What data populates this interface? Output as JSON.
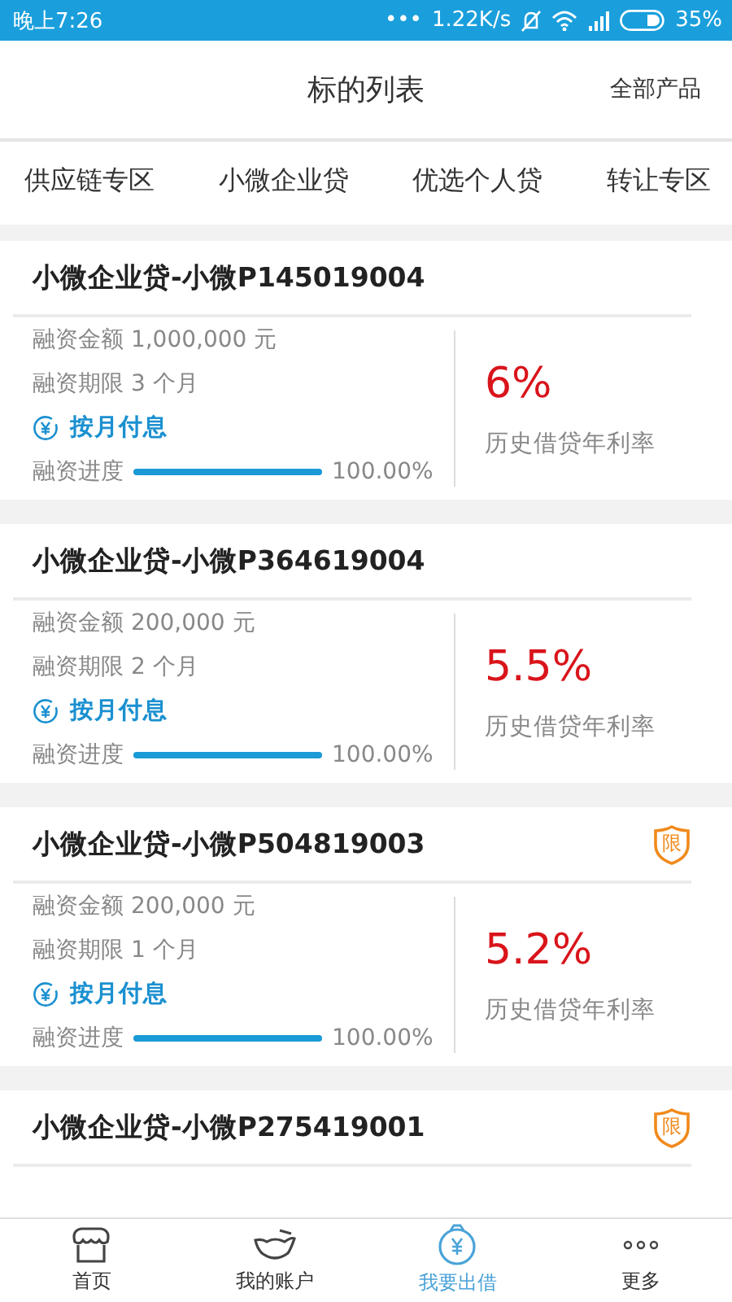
{
  "status_bar": {
    "time": "晚上7:26",
    "dots": "•••",
    "speed": "1.22K/s",
    "battery": "35%"
  },
  "header": {
    "title": "标的列表",
    "action": "全部产品"
  },
  "tabs": [
    {
      "label": "供应链专区",
      "selected": false
    },
    {
      "label": "小微企业贷",
      "selected": false
    },
    {
      "label": "优选个人贷",
      "selected": false
    },
    {
      "label": "转让专区",
      "selected": false
    }
  ],
  "loans": [
    {
      "title": "小微企业贷-小微P145019004",
      "amount": "融资金额 1,000,000 元",
      "term": "融资期限 3 个月",
      "repayment": "按月付息",
      "progress_label": "融资进度",
      "level": 1,
      "progress": "100.00%",
      "rate": "6%",
      "rate_label": "历史借贷年利率"
    },
    {
      "title": "小微企业贷-小微P364619004",
      "amount": "融资金额 200,000 元",
      "term": "融资期限 2 个月",
      "repayment": "按月付息",
      "progress_label": "融资进度",
      "level": 1,
      "progress": "100.00%",
      "rate": "5.5%",
      "rate_label": "历史借贷年利率"
    },
    {
      "title": "小微企业贷-小微P504819003",
      "badge": "限",
      "amount": "融资金额 200,000 元",
      "term": "融资期限 1 个月",
      "repayment": "按月付息",
      "progress_label": "融资进度",
      "level": 1,
      "progress": "100.00%",
      "rate": "5.2%",
      "rate_label": "历史借贷年利率"
    },
    {
      "title": "小微企业贷-小微P275419001",
      "badge": "限"
    }
  ],
  "nav": [
    {
      "kind": "home",
      "label": "首页",
      "selected": false
    },
    {
      "kind": "account",
      "label": "我的账户",
      "selected": false
    },
    {
      "kind": "lend",
      "label": "我要出借",
      "selected": true
    },
    {
      "kind": "more",
      "label": "更多",
      "selected": false
    }
  ]
}
